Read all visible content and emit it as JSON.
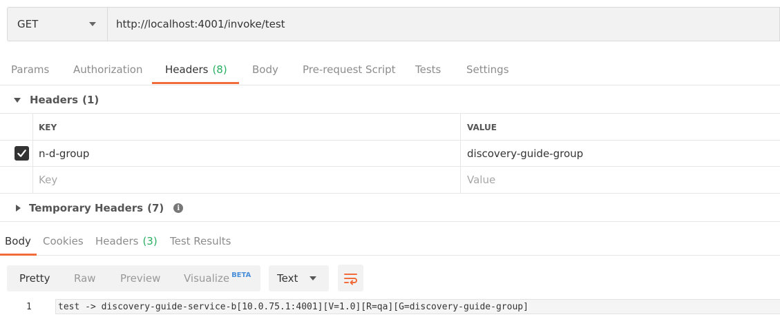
{
  "request": {
    "method": "GET",
    "url": "http://localhost:4001/invoke/test"
  },
  "request_tabs": [
    {
      "label": "Params",
      "count": ""
    },
    {
      "label": "Authorization",
      "count": ""
    },
    {
      "label": "Headers",
      "count": "(8)"
    },
    {
      "label": "Body",
      "count": ""
    },
    {
      "label": "Pre-request Script",
      "count": ""
    },
    {
      "label": "Tests",
      "count": ""
    },
    {
      "label": "Settings",
      "count": ""
    }
  ],
  "headers_section": {
    "title": "Headers",
    "count": "(1)",
    "columns": {
      "key": "KEY",
      "value": "VALUE"
    },
    "rows": [
      {
        "key": "n-d-group",
        "value": "discovery-guide-group",
        "enabled": true
      }
    ],
    "placeholder": {
      "key": "Key",
      "value": "Value"
    }
  },
  "temporary_headers": {
    "title": "Temporary Headers",
    "count": "(7)",
    "info_icon": "info-icon"
  },
  "response_tabs": [
    {
      "label": "Body",
      "count": ""
    },
    {
      "label": "Cookies",
      "count": ""
    },
    {
      "label": "Headers",
      "count": "(3)"
    },
    {
      "label": "Test Results",
      "count": ""
    }
  ],
  "view_options": {
    "pretty": "Pretty",
    "raw": "Raw",
    "preview": "Preview",
    "visualize": "Visualize",
    "visualize_badge": "BETA"
  },
  "format": "Text",
  "response_body": {
    "line_number": "1",
    "text": "test -> discovery-guide-service-b[10.0.75.1:4001][V=1.0][R=qa][G=discovery-guide-group]"
  },
  "colors": {
    "accent": "#f26b3a",
    "count_green": "#27ae60",
    "beta_blue": "#4a8fd9"
  }
}
